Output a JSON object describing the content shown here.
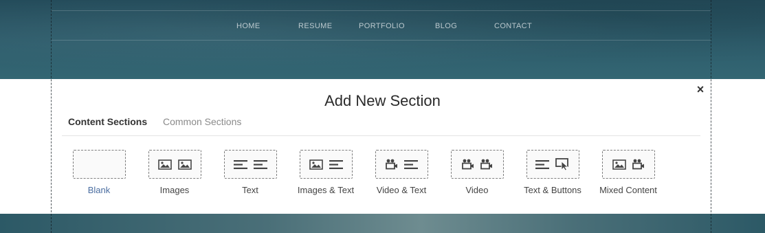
{
  "nav": {
    "items": [
      "HOME",
      "RESUME",
      "PORTFOLIO",
      "BLOG",
      "CONTACT"
    ]
  },
  "dialog": {
    "title": "Add New Section",
    "close_label": "×",
    "tabs": [
      {
        "label": "Content Sections",
        "active": true
      },
      {
        "label": "Common Sections",
        "active": false
      }
    ],
    "tiles": [
      {
        "label": "Blank",
        "icons": []
      },
      {
        "label": "Images",
        "icons": [
          "image-icon",
          "image-icon"
        ]
      },
      {
        "label": "Text",
        "icons": [
          "text-lines-icon",
          "text-lines-icon"
        ]
      },
      {
        "label": "Images & Text",
        "icons": [
          "image-icon",
          "text-lines-icon"
        ]
      },
      {
        "label": "Video & Text",
        "icons": [
          "video-camera-icon",
          "text-lines-icon"
        ]
      },
      {
        "label": "Video",
        "icons": [
          "video-camera-icon",
          "video-camera-icon"
        ]
      },
      {
        "label": "Text & Buttons",
        "icons": [
          "text-lines-icon",
          "button-cursor-icon"
        ]
      },
      {
        "label": "Mixed Content",
        "icons": [
          "image-icon",
          "video-camera-icon"
        ]
      }
    ]
  },
  "colors": {
    "accent_link": "#4a6da0",
    "background_teal": "#2b5766",
    "panel": "#ffffff"
  }
}
